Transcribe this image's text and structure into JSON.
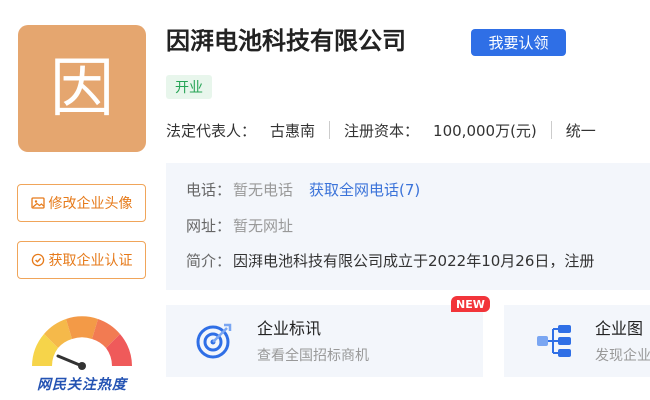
{
  "company": {
    "logo_char": "因",
    "name": "因湃电池科技有限公司",
    "claim_label": "我要认领",
    "status": "开业"
  },
  "meta": {
    "legal_rep_label": "法定代表人：",
    "legal_rep": "古惠南",
    "capital_label": "注册资本：",
    "capital": "100,000万(元)",
    "credit_label": "统一"
  },
  "info": {
    "phone_label": "电话：",
    "phone_value": "暂无电话",
    "phone_link": "获取全网电话(7)",
    "site_label": "网址：",
    "site_value": "暂无网址",
    "intro_label": "简介：",
    "intro_value": "因湃电池科技有限公司成立于2022年10月26日，注册"
  },
  "sidebar": {
    "edit_avatar_label": "修改企业头像",
    "get_cert_label": "获取企业认证",
    "heat_label": "网民关注热度"
  },
  "cards": {
    "news_title": "企业标讯",
    "news_sub": "查看全国招标商机",
    "new_badge": "NEW",
    "graph_title": "企业图",
    "graph_sub": "发现企业"
  },
  "colors": {
    "accent": "#2f6fe6",
    "logo_bg": "#e5a66f",
    "orange": "#e67a1a",
    "status_green": "#26a455",
    "new_red": "#f2353a"
  },
  "icons": {
    "avatar_icon": "image-icon",
    "cert_icon": "shield-check-icon",
    "news_icon": "target-icon",
    "graph_icon": "org-chart-icon",
    "heat_icon": "gauge-icon"
  }
}
